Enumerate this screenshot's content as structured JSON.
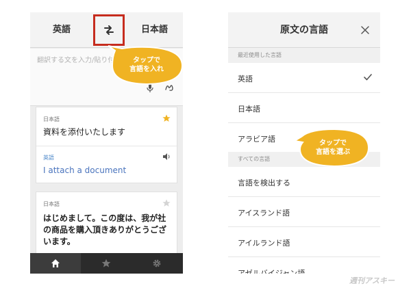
{
  "left_screen": {
    "source_language": "英語",
    "target_language": "日本語",
    "input_placeholder": "翻訳する文を入力/貼り付け",
    "history": [
      {
        "source_lang": "日本語",
        "source_text": "資料を添付いたします",
        "starred": true,
        "target_lang": "英語",
        "target_text": "I attach a document"
      },
      {
        "source_lang": "日本語",
        "source_text": "はじめまして。この度は、我が社の商品を購入頂きありがとうございます。",
        "starred": false
      }
    ],
    "tabs": [
      "home",
      "favorites",
      "settings"
    ]
  },
  "right_screen": {
    "title": "原文の言語",
    "recent_header": "最近使用した言語",
    "recent_languages": [
      "英語",
      "日本語",
      "アラビア語"
    ],
    "selected_language": "英語",
    "all_header": "すべての言語",
    "all_languages": [
      "言語を検出する",
      "アイスランド語",
      "アイルランド語",
      "アゼルバイジャン語"
    ]
  },
  "callouts": {
    "first": [
      "タップで",
      "言語を入れ"
    ],
    "second": [
      "タップで",
      "言語を選ぶ"
    ]
  },
  "watermark": "週刊アスキー",
  "colors": {
    "highlight_box": "#c62c1e",
    "callout_fill": "#f0b323",
    "translation_text": "#4a74bd",
    "star_active": "#f0b323"
  }
}
